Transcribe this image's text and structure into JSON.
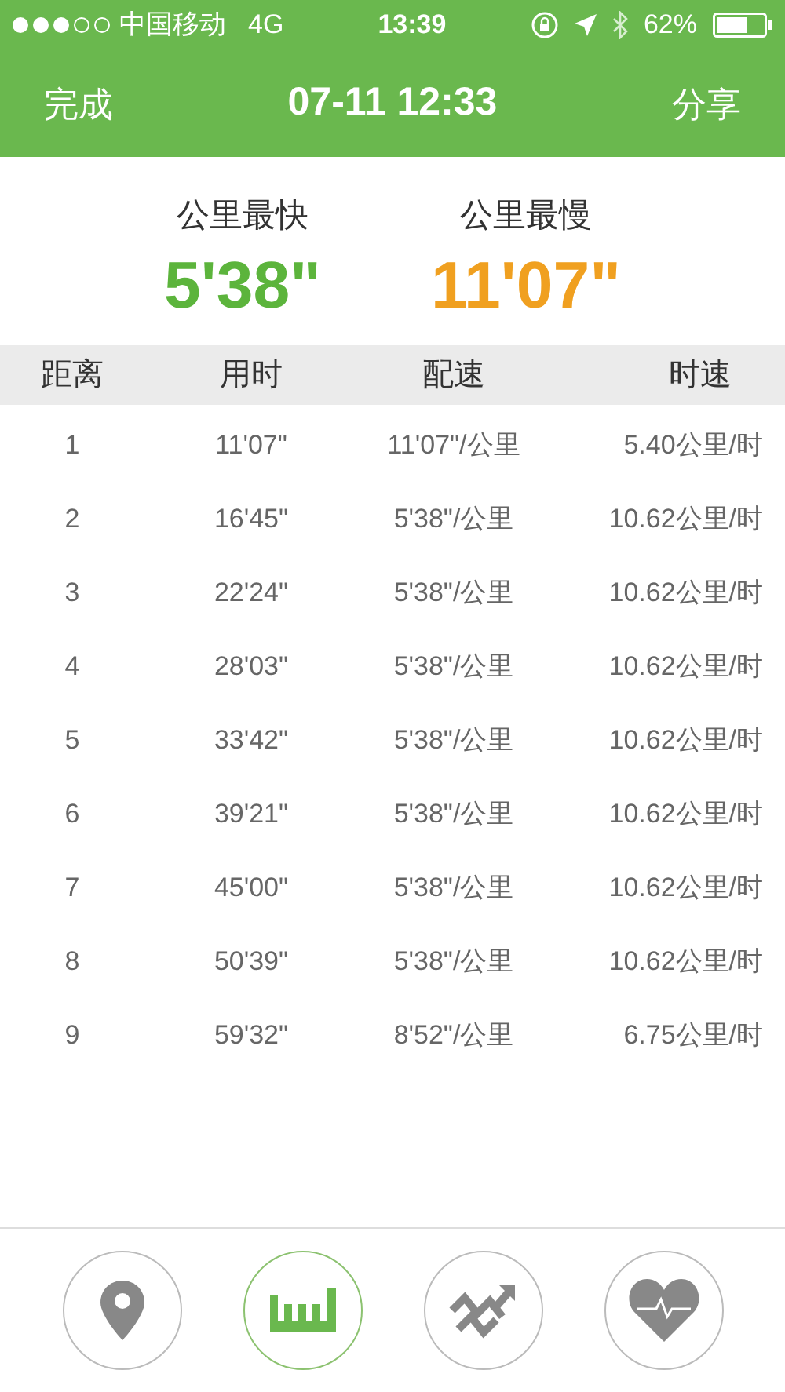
{
  "status_bar": {
    "carrier": "中国移动",
    "network": "4G",
    "time": "13:39",
    "battery": "62%"
  },
  "nav_bar": {
    "left": "完成",
    "title": "07-11 12:33",
    "right": "分享"
  },
  "summary": [
    {
      "label": "公里最快",
      "value": "5'38\"",
      "color": "#5cb43c"
    },
    {
      "label": "公里最慢",
      "value": "11'07\"",
      "color": "#f0a020"
    }
  ],
  "table": {
    "columns": [
      "距离",
      "用时",
      "配速",
      "时速"
    ],
    "rows": [
      [
        "1",
        "11'07\"",
        "11'07\"/公里",
        "5.40公里/时"
      ],
      [
        "2",
        "16'45\"",
        "5'38\"/公里",
        "10.62公里/时"
      ],
      [
        "3",
        "22'24\"",
        "5'38\"/公里",
        "10.62公里/时"
      ],
      [
        "4",
        "28'03\"",
        "5'38\"/公里",
        "10.62公里/时"
      ],
      [
        "5",
        "33'42\"",
        "5'38\"/公里",
        "10.62公里/时"
      ],
      [
        "6",
        "39'21\"",
        "5'38\"/公里",
        "10.62公里/时"
      ],
      [
        "7",
        "45'00\"",
        "5'38\"/公里",
        "10.62公里/时"
      ],
      [
        "8",
        "50'39\"",
        "5'38\"/公里",
        "10.62公里/时"
      ],
      [
        "9",
        "59'32\"",
        "8'52\"/公里",
        "6.75公里/时"
      ]
    ]
  },
  "tab_bar": [
    {
      "kind": "map",
      "selected": false
    },
    {
      "kind": "splits",
      "selected": true
    },
    {
      "kind": "chart",
      "selected": false
    },
    {
      "kind": "heart",
      "selected": false
    }
  ]
}
